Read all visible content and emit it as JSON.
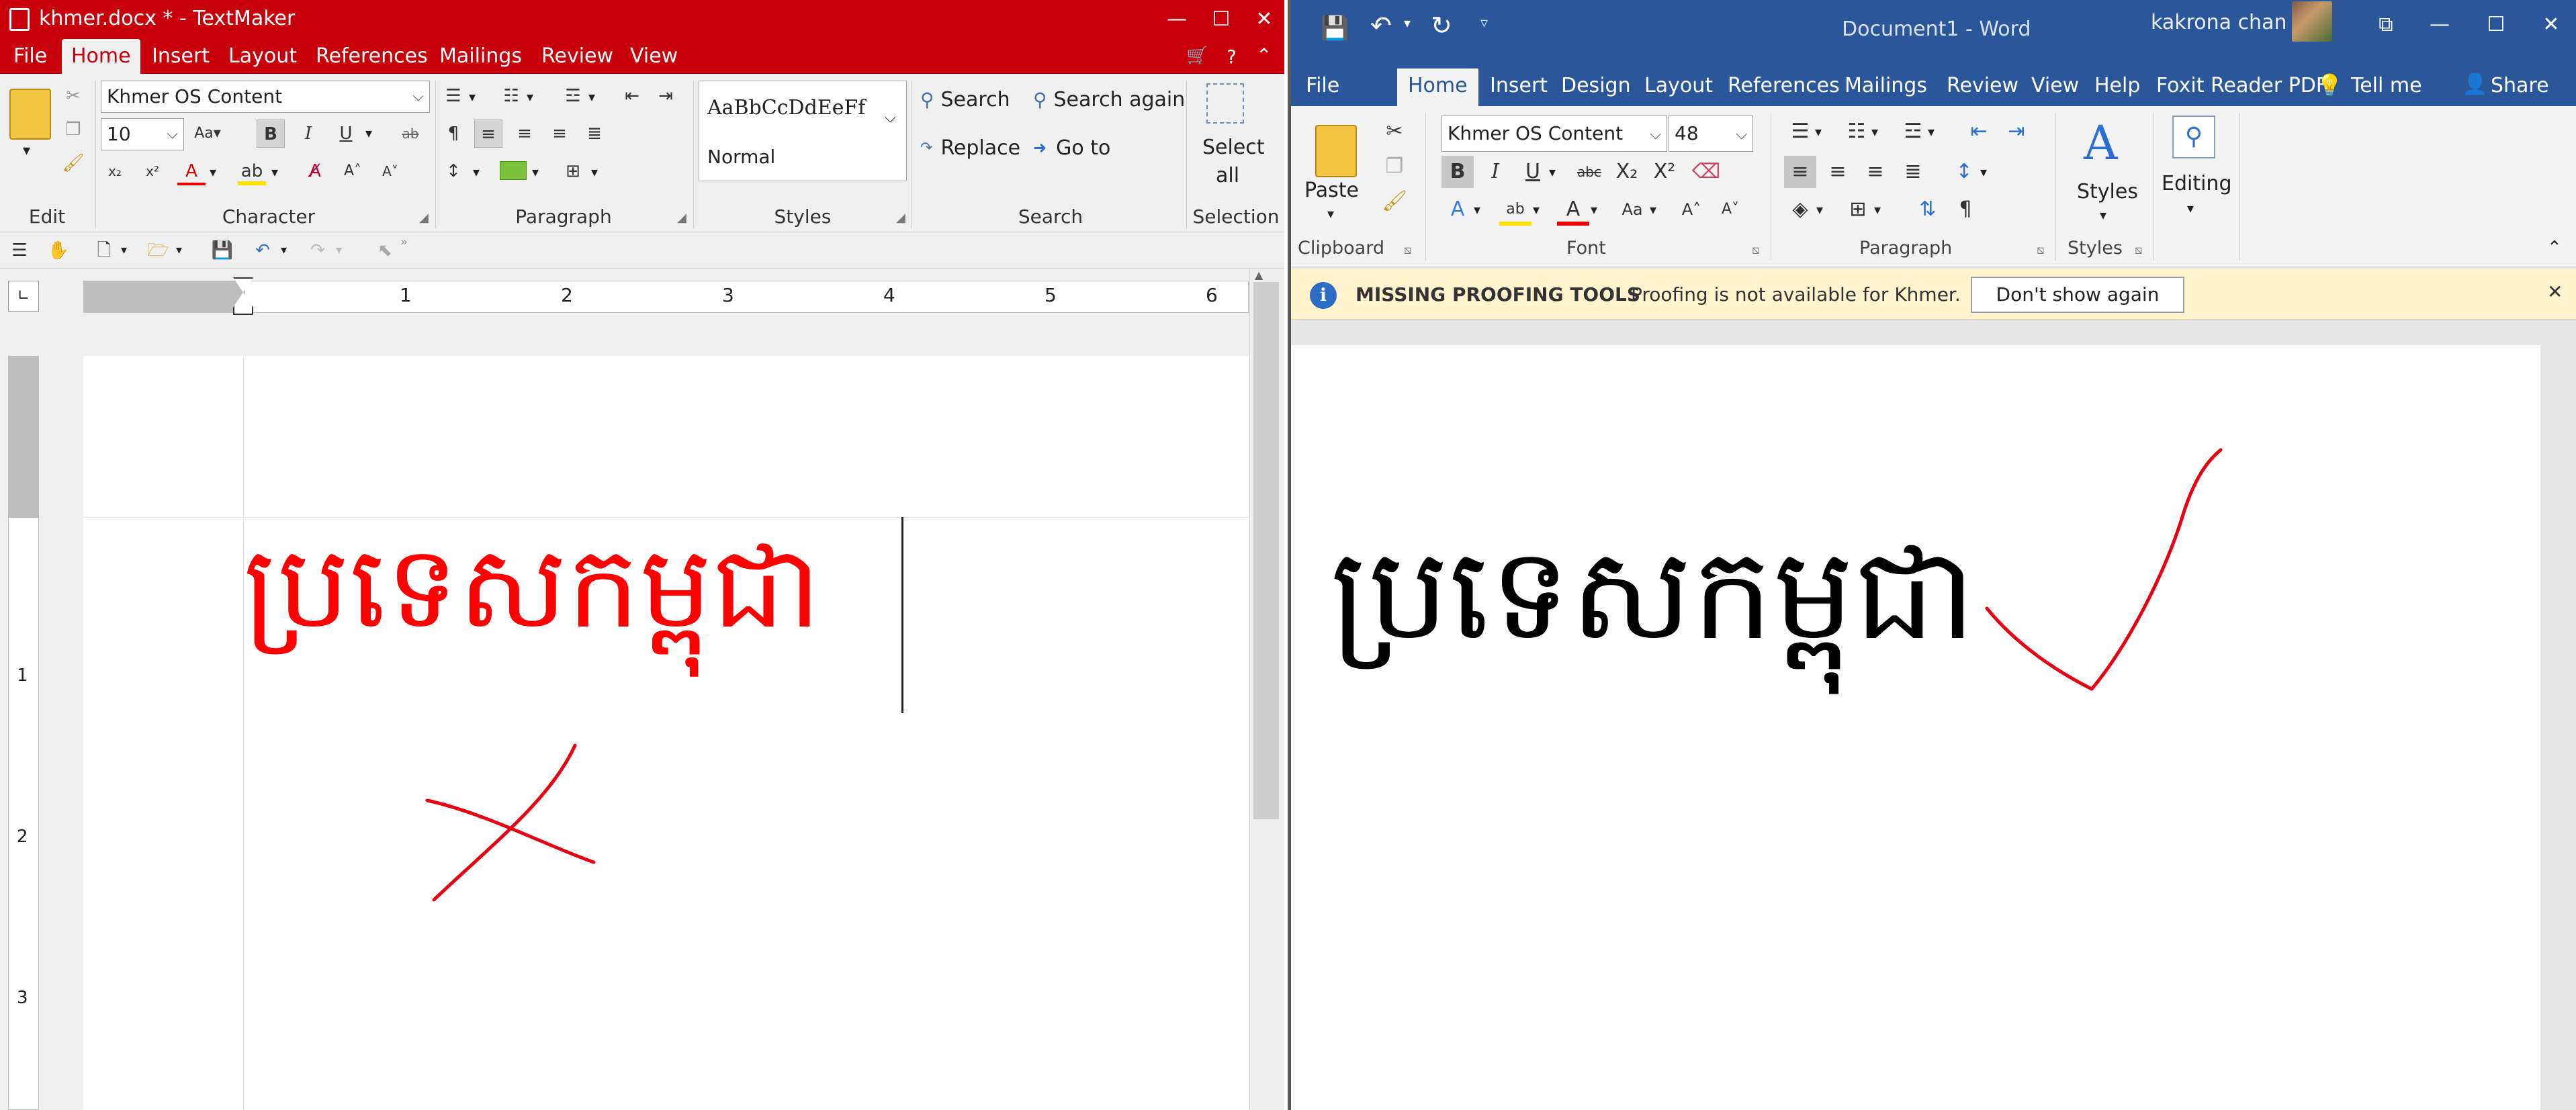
{
  "textmaker": {
    "title": "khmer.docx * - TextMaker",
    "tabs": [
      "File",
      "Home",
      "Insert",
      "Layout",
      "References",
      "Mailings",
      "Review",
      "View"
    ],
    "font_name": "Khmer OS Content",
    "font_size": "10",
    "style_sample": "AaBbCcDdEeFf",
    "style_name": "Normal",
    "search": "Search",
    "search_again": "Search again",
    "replace": "Replace",
    "goto": "Go to",
    "select_all_1": "Select",
    "select_all_2": "all",
    "groups": [
      "Edit",
      "Character",
      "Paragraph",
      "Styles",
      "Search",
      "Selection"
    ],
    "ruler_numbers": [
      "1",
      "2",
      "3",
      "4",
      "5",
      "6"
    ],
    "vruler_numbers": [
      "1",
      "2",
      "3"
    ],
    "document_text": "ប្រទេសកម្ពុជា",
    "colors": {
      "accent": "#c8000c",
      "text": "#ff0000"
    }
  },
  "word": {
    "title": "Document1  -  Word",
    "user": "kakrona chan",
    "tabs": [
      "File",
      "Home",
      "Insert",
      "Design",
      "Layout",
      "References",
      "Mailings",
      "Review",
      "View",
      "Help",
      "Foxit Reader PDF",
      "Tell me",
      "Share"
    ],
    "font_name": "Khmer OS Content",
    "font_size": "48",
    "paste": "Paste",
    "styles": "Styles",
    "editing": "Editing",
    "groups": [
      "Clipboard",
      "Font",
      "Paragraph",
      "Styles"
    ],
    "info_bar": {
      "title": "MISSING PROOFING TOOLS",
      "message": "Proofing is not available for Khmer.",
      "button": "Don't show again"
    },
    "document_text": "ប្រទេសកម្ពុជា",
    "colors": {
      "accent": "#2b579a",
      "info_bg": "#fff4ce"
    }
  }
}
